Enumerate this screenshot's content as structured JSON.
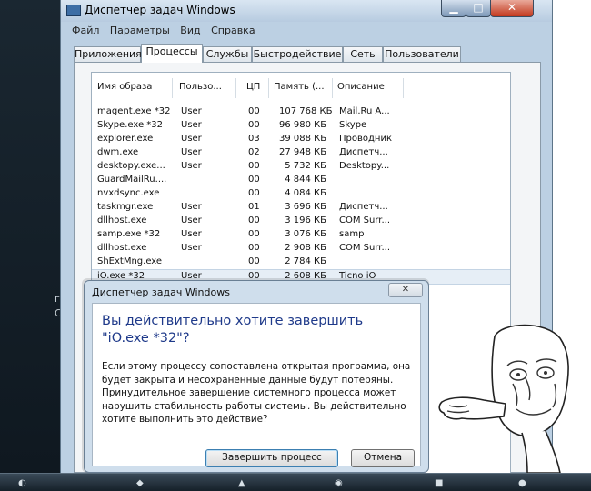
{
  "window": {
    "title": "Диспетчер задач Windows",
    "buttons": {
      "minimize": "▁",
      "maximize": "□",
      "close": "✕"
    }
  },
  "menu": [
    "Файл",
    "Параметры",
    "Вид",
    "Справка"
  ],
  "tabs": [
    "Приложения",
    "Процессы",
    "Службы",
    "Быстродействие",
    "Сеть",
    "Пользователи"
  ],
  "active_tab": "Процессы",
  "columns": [
    "Имя образа",
    "Пользо...",
    "ЦП",
    "Память (...",
    "Описание"
  ],
  "processes": [
    {
      "name": "magent.exe *32",
      "user": "User",
      "cpu": "00",
      "mem": "107 768 КБ",
      "desc": "Mail.Ru A..."
    },
    {
      "name": "Skype.exe *32",
      "user": "User",
      "cpu": "00",
      "mem": "96 980 КБ",
      "desc": "Skype"
    },
    {
      "name": "explorer.exe",
      "user": "User",
      "cpu": "03",
      "mem": "39 088 КБ",
      "desc": "Проводник"
    },
    {
      "name": "dwm.exe",
      "user": "User",
      "cpu": "02",
      "mem": "27 948 КБ",
      "desc": "Диспетч..."
    },
    {
      "name": "desktopy.exe...",
      "user": "User",
      "cpu": "00",
      "mem": "5 732 КБ",
      "desc": "Desktopy..."
    },
    {
      "name": "GuardMailRu....",
      "user": "",
      "cpu": "00",
      "mem": "4 844 КБ",
      "desc": ""
    },
    {
      "name": "nvxdsync.exe",
      "user": "",
      "cpu": "00",
      "mem": "4 084 КБ",
      "desc": ""
    },
    {
      "name": "taskmgr.exe",
      "user": "User",
      "cpu": "01",
      "mem": "3 696 КБ",
      "desc": "Диспетч..."
    },
    {
      "name": "dllhost.exe",
      "user": "User",
      "cpu": "00",
      "mem": "3 196 КБ",
      "desc": "COM Surr..."
    },
    {
      "name": "samp.exe *32",
      "user": "User",
      "cpu": "00",
      "mem": "3 076 КБ",
      "desc": "samp"
    },
    {
      "name": "dllhost.exe",
      "user": "User",
      "cpu": "00",
      "mem": "2 908 КБ",
      "desc": "COM Surr..."
    },
    {
      "name": "ShExtMng.exe",
      "user": "",
      "cpu": "00",
      "mem": "2 784 КБ",
      "desc": ""
    },
    {
      "name": "iO.exe *32",
      "user": "User",
      "cpu": "00",
      "mem": "2 608 КБ",
      "desc": "Ticno iO"
    }
  ],
  "selected_process_index": 12,
  "dialog": {
    "title": "Диспетчер задач Windows",
    "close": "✕",
    "heading": "Вы действительно хотите завершить \"iO.exe *32\"?",
    "body": "Если этому процессу сопоставлена открытая программа, она будет закрыта и несохраненные данные будут потеряны. Принудительное завершение системного процесса может нарушить стабильность работы системы. Вы действительно хотите выполнить это действие?",
    "confirm": "Завершить процесс",
    "cancel": "Отмена"
  },
  "colors": {
    "window_frame": "#bcd0e3",
    "dialog_heading": "#1f3a8a",
    "close_button": "#c2381c",
    "taskbar": "#152029"
  }
}
